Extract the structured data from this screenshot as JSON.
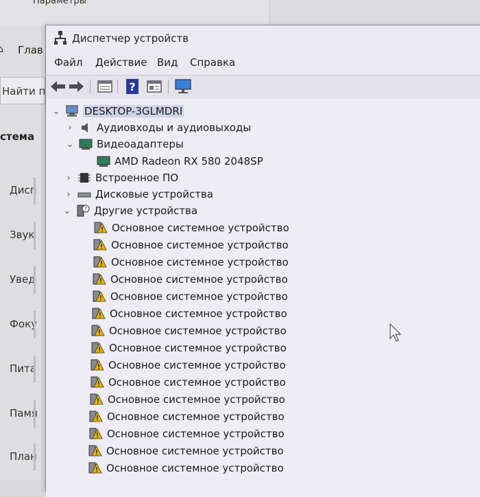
{
  "background": {
    "window_title": "Параметры",
    "nav_label": "Глав",
    "search_placeholder": "Найти п",
    "section_title": "стема",
    "items": [
      "Дисп",
      "Звук",
      "Увед",
      "Фоку",
      "Пита",
      "Памя",
      "План"
    ]
  },
  "device_manager": {
    "title": "Диспетчер устройств",
    "menu": [
      "Файл",
      "Действие",
      "Вид",
      "Справка"
    ],
    "toolbar": {
      "icons": [
        "back-arrow-icon",
        "forward-arrow-icon",
        "properties-grid-icon",
        "help-icon",
        "view-list-icon",
        "monitor-scan-icon"
      ]
    },
    "tree": {
      "root": "DESKTOP-3GLMDRI",
      "categories": [
        {
          "label": "Аудиовходы и аудиовыходы",
          "expanded": false,
          "icon": "speaker-icon"
        },
        {
          "label": "Видеоадаптеры",
          "expanded": true,
          "icon": "display-adapter-icon",
          "children": [
            "AMD Radeon RX 580 2048SP"
          ]
        },
        {
          "label": "Встроенное ПО",
          "expanded": false,
          "icon": "firmware-chip-icon"
        },
        {
          "label": "Дисковые устройства",
          "expanded": false,
          "icon": "disk-drive-icon"
        },
        {
          "label": "Другие устройства",
          "expanded": true,
          "icon": "unknown-device-icon",
          "children": [
            "Основное системное устройство",
            "Основное системное устройство",
            "Основное системное устройство",
            "Основное системное устройство",
            "Основное системное устройство",
            "Основное системное устройство",
            "Основное системное устройство",
            "Основное системное устройство",
            "Основное системное устройство",
            "Основное системное устройство",
            "Основное системное устройство",
            "Основное системное устройство",
            "Основное системное устройство",
            "Основное системное устройство",
            "Основное системное устройство"
          ]
        }
      ]
    }
  },
  "colors": {
    "window_bg": "#eceaf4",
    "selection": "#cfd3e6",
    "warning": "#e8b400"
  }
}
